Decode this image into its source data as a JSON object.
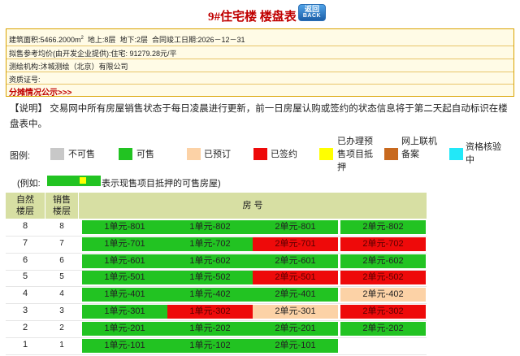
{
  "header": {
    "title": "9#住宅楼 楼盘表",
    "back_label_cn": "返回",
    "back_label_en": "BACK"
  },
  "info": {
    "area_label": "建筑面积:5466.2000m",
    "area_sup": "2",
    "floors_above": "地上:8层",
    "floors_below": "地下:2层",
    "completion": "合同竣工日期:2026－12－31",
    "price": "拟售参考均价(由开发企业提供):住宅:  91279.28元/平",
    "survey": "测绘机构:沐城测绘（北京）有限公司",
    "cert": "资质证号:",
    "allocation_link": "分摊情况公示>>>"
  },
  "notice": "【说明】 交易网中所有房屋销售状态于每日凌晨进行更新，前一日房屋认购或签约的状态信息将于第二天起自动标识在楼盘表中。",
  "legend": {
    "label": "图例:",
    "items": [
      {
        "text": "不可售",
        "color": "#c8c8c8"
      },
      {
        "text": "可售",
        "color": "#22c322"
      },
      {
        "text": "已预订",
        "color": "#fcd2a6"
      },
      {
        "text": "已签约",
        "color": "#ee0a0a"
      },
      {
        "text": "已办理预售项目抵押",
        "color": "#ffff00"
      },
      {
        "text": "网上联机备案",
        "color": "#c8691e"
      },
      {
        "text": "资格核验中",
        "color": "#22e8f8"
      }
    ]
  },
  "example": {
    "prefix": "(例如:",
    "suffix": "表示现售项目抵押的可售房屋)"
  },
  "table": {
    "col_floor": "自然楼层",
    "col_sale_floor": "销售楼层",
    "col_rooms": "房 号",
    "rows": [
      {
        "floor": "8",
        "sale": "8",
        "units": [
          [
            "1单元-801",
            "green"
          ],
          [
            "1单元-802",
            "green"
          ],
          [
            "2单元-801",
            "green"
          ],
          [
            "2单元-802",
            "green"
          ]
        ]
      },
      {
        "floor": "7",
        "sale": "7",
        "units": [
          [
            "1单元-701",
            "green"
          ],
          [
            "1单元-702",
            "green"
          ],
          [
            "2单元-701",
            "red"
          ],
          [
            "2单元-702",
            "red"
          ]
        ]
      },
      {
        "floor": "6",
        "sale": "6",
        "units": [
          [
            "1单元-601",
            "green"
          ],
          [
            "1单元-602",
            "green"
          ],
          [
            "2单元-601",
            "green"
          ],
          [
            "2单元-602",
            "green"
          ]
        ]
      },
      {
        "floor": "5",
        "sale": "5",
        "units": [
          [
            "1单元-501",
            "green"
          ],
          [
            "1单元-502",
            "green"
          ],
          [
            "2单元-501",
            "red"
          ],
          [
            "2单元-502",
            "red"
          ]
        ]
      },
      {
        "floor": "4",
        "sale": "4",
        "units": [
          [
            "1单元-401",
            "green"
          ],
          [
            "1单元-402",
            "green"
          ],
          [
            "2单元-401",
            "green"
          ],
          [
            "2单元-402",
            "peach"
          ]
        ]
      },
      {
        "floor": "3",
        "sale": "3",
        "units": [
          [
            "1单元-301",
            "green"
          ],
          [
            "1单元-302",
            "red"
          ],
          [
            "2单元-301",
            "peach"
          ],
          [
            "2单元-302",
            "red"
          ]
        ]
      },
      {
        "floor": "2",
        "sale": "2",
        "units": [
          [
            "1单元-201",
            "green"
          ],
          [
            "1单元-202",
            "green"
          ],
          [
            "2单元-201",
            "green"
          ],
          [
            "2单元-202",
            "green"
          ]
        ]
      },
      {
        "floor": "1",
        "sale": "1",
        "units": [
          [
            "1单元-101",
            "green"
          ],
          [
            "1单元-102",
            "green"
          ],
          [
            "2单元-101",
            "green"
          ]
        ]
      }
    ]
  }
}
